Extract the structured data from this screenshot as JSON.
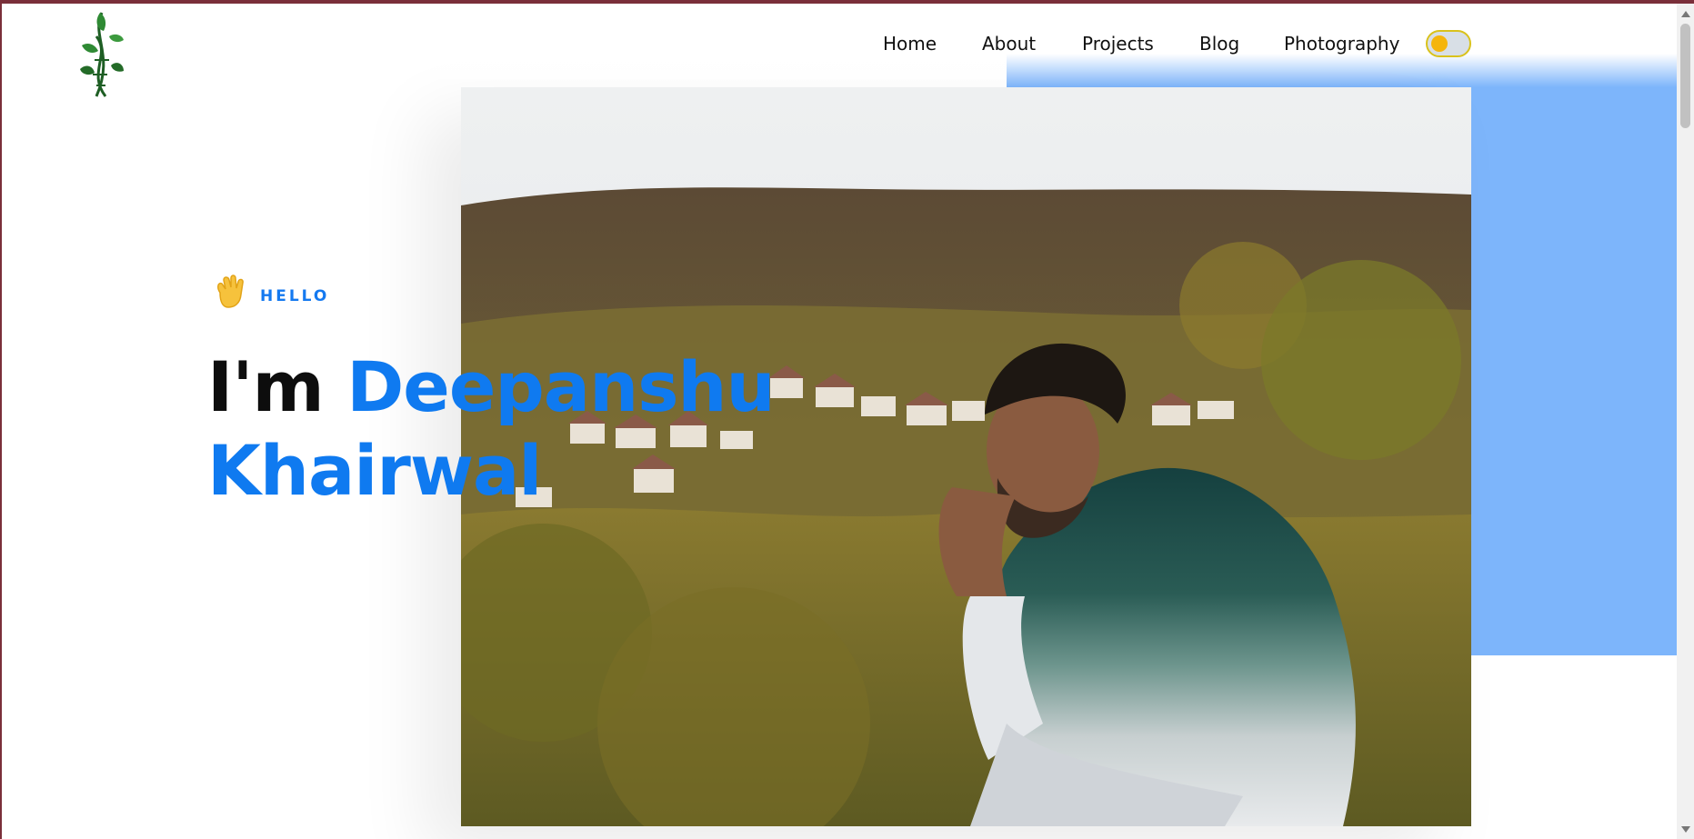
{
  "nav": {
    "items": [
      {
        "label": "Home"
      },
      {
        "label": "About"
      },
      {
        "label": "Projects"
      },
      {
        "label": "Blog"
      },
      {
        "label": "Photography"
      }
    ],
    "theme_toggle": {
      "state": "light",
      "knob_color": "#f5b50c"
    }
  },
  "hero": {
    "greeting_icon": "waving-hand-icon",
    "greeting": "HELLO",
    "intro": "I'm",
    "first_name": "Deepanshu",
    "last_name": "Khairwal",
    "photo": "portrait-photo"
  },
  "colors": {
    "accent": "#0f7af0",
    "panel": "#7db5fb",
    "frame": "#7a2f3a"
  },
  "logo": {
    "icon": "leaf-dna-logo-icon"
  }
}
